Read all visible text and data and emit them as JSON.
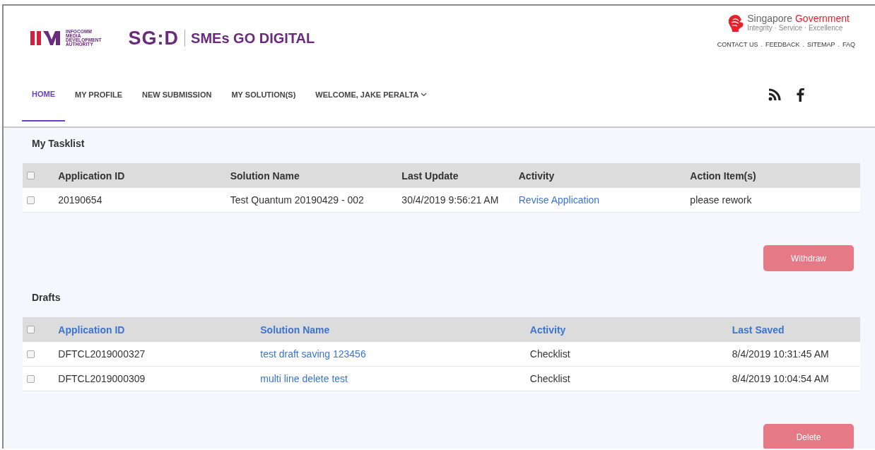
{
  "header": {
    "agency_logo": [
      "INFOCOMM",
      "MEDIA",
      "DEVELOPMENT",
      "AUTHORITY"
    ],
    "brand": {
      "mark": "SG:D",
      "name": "SMEs GO DIGITAL"
    },
    "government": {
      "name": "Singapore",
      "name_accent": "Government",
      "motto": "Integrity · Service · Excellence"
    },
    "top_links": [
      "CONTACT US",
      "FEEDBACK",
      "SITEMAP",
      "FAQ"
    ],
    "top_link_separator": "."
  },
  "nav": {
    "items": [
      {
        "label": "HOME",
        "selected": true,
        "dropdown": false
      },
      {
        "label": "MY PROFILE",
        "selected": false,
        "dropdown": false
      },
      {
        "label": "NEW SUBMISSION",
        "selected": false,
        "dropdown": false
      },
      {
        "label": "MY SOLUTION(S)",
        "selected": false,
        "dropdown": false
      },
      {
        "label": "WELCOME, JAKE PERALTA",
        "selected": false,
        "dropdown": true
      }
    ]
  },
  "tasklist": {
    "title": "My Tasklist",
    "all_checked": false,
    "columns": [
      {
        "label": "Application ID",
        "sortable": false
      },
      {
        "label": "Solution Name",
        "sortable": false
      },
      {
        "label": "Last Update",
        "sortable": false
      },
      {
        "label": "Activity",
        "sortable": false
      },
      {
        "label": "Action Item(s)",
        "sortable": false
      }
    ],
    "rows": [
      {
        "checked": false,
        "cells": [
          {
            "text": "20190654",
            "kind": "text"
          },
          {
            "text": "Test Quantum 20190429 - 002",
            "kind": "text"
          },
          {
            "text": "30/4/2019 9:56:21 AM",
            "kind": "text"
          },
          {
            "text": "Revise Application",
            "kind": "link"
          },
          {
            "text": "please rework",
            "kind": "text"
          }
        ]
      }
    ],
    "button": "Withdraw"
  },
  "drafts": {
    "title": "Drafts",
    "all_checked": false,
    "columns": [
      {
        "label": "Application ID",
        "sortable": true
      },
      {
        "label": "Solution Name",
        "sortable": true
      },
      {
        "label": "Activity",
        "sortable": true
      },
      {
        "label": "Last Saved",
        "sortable": true
      }
    ],
    "rows": [
      {
        "checked": false,
        "cells": [
          {
            "text": "DFTCL2019000327",
            "kind": "text"
          },
          {
            "text": "test draft saving 123456",
            "kind": "link"
          },
          {
            "text": "Checklist",
            "kind": "text"
          },
          {
            "text": "8/4/2019 10:31:45 AM",
            "kind": "text"
          }
        ]
      },
      {
        "checked": false,
        "cells": [
          {
            "text": "DFTCL2019000309",
            "kind": "text"
          },
          {
            "text": "multi line delete test",
            "kind": "link"
          },
          {
            "text": "Checklist",
            "kind": "text"
          },
          {
            "text": "8/4/2019 10:04:54 AM",
            "kind": "text"
          }
        ]
      }
    ],
    "button": "Delete"
  }
}
